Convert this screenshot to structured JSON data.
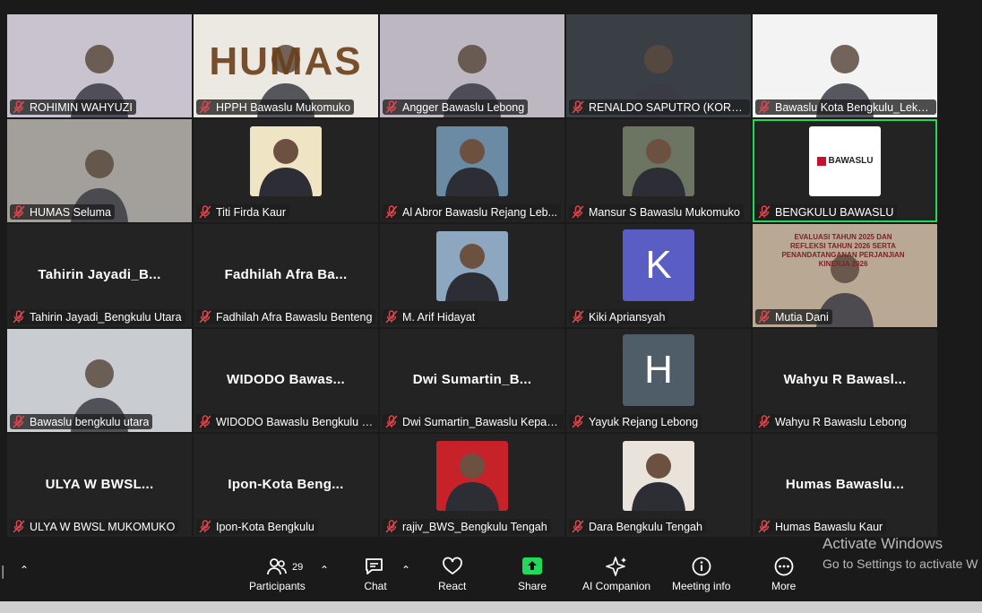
{
  "participants": [
    {
      "name": "ROHIMIN WAHYUZI",
      "type": "video",
      "bg": "#c8c3cf"
    },
    {
      "name": "HPPH Bawaslu Mukomuko",
      "type": "video",
      "bg": "#ece8e2",
      "overlay_text": "HUMAS"
    },
    {
      "name": "Angger Bawaslu Lebong",
      "type": "video",
      "bg": "#bdb7c2"
    },
    {
      "name": "RENALDO SAPUTRO (KORDIV...",
      "type": "video",
      "bg": "#3a3f45"
    },
    {
      "name": "Bawaslu Kota Bengkulu_Leka ...",
      "type": "video",
      "bg": "#f3f3f3"
    },
    {
      "name": "HUMAS Seluma",
      "type": "video",
      "bg": "#a3a09c"
    },
    {
      "name": "Titi Firda Kaur",
      "type": "photo",
      "bg": "#efe5c4"
    },
    {
      "name": "Al Abror Bawaslu Rejang Leb...",
      "type": "photo",
      "bg": "#6b8aa3"
    },
    {
      "name": "Mansur S Bawaslu Mukomuko",
      "type": "photo",
      "bg": "#6c7561"
    },
    {
      "name": "BENGKULU BAWASLU",
      "type": "logo",
      "bg": "#ffffff",
      "active": true,
      "logo_text": "BAWASLU"
    },
    {
      "name": "Tahirin Jayadi_Bengkulu Utara",
      "type": "name",
      "display": "Tahirin Jayadi_B..."
    },
    {
      "name": "Fadhilah Afra Bawaslu Benteng",
      "type": "name",
      "display": "Fadhilah Afra Ba..."
    },
    {
      "name": "M. Arif Hidayat",
      "type": "photo",
      "bg": "#8ea7c0"
    },
    {
      "name": "Kiki Apriansyah",
      "type": "avatar",
      "letter": "K",
      "bg": "#5a5ec4"
    },
    {
      "name": "Mutia Dani",
      "type": "video",
      "bg": "#b9a893",
      "overlay_text": "EVALUASI TAHUN 2025 DAN REFLEKSI TAHUN 2026 SERTA PENANDATANGANAN PERJANJIAN KINERJA 2026"
    },
    {
      "name": "Bawaslu bengkulu utara",
      "type": "video",
      "bg": "#c9ccd0"
    },
    {
      "name": "WIDODO Bawaslu Bengkulu S...",
      "type": "name",
      "display": "WIDODO Bawas..."
    },
    {
      "name": "Dwi Sumartin_Bawaslu Kepahi...",
      "type": "name",
      "display": "Dwi Sumartin_B..."
    },
    {
      "name": "Yayuk Rejang Lebong",
      "type": "avatar",
      "letter": "H",
      "bg": "#4e5d68"
    },
    {
      "name": "Wahyu R Bawaslu Lebong",
      "type": "name",
      "display": "Wahyu R Bawasl..."
    },
    {
      "name": "ULYA W  BWSL MUKOMUKO",
      "type": "name",
      "display": "ULYA W  BWSL..."
    },
    {
      "name": "Ipon-Kota Bengkulu",
      "type": "name",
      "display": "Ipon-Kota Beng..."
    },
    {
      "name": "rajiv_BWS_Bengkulu Tengah",
      "type": "photo",
      "bg": "#c7212a"
    },
    {
      "name": "Dara Bengkulu Tengah",
      "type": "photo",
      "bg": "#e9e3dc"
    },
    {
      "name": "Humas Bawaslu Kaur",
      "type": "name",
      "display": "Humas Bawaslu..."
    }
  ],
  "toolbar": {
    "participants_label": "Participants",
    "participants_count": "29",
    "chat_label": "Chat",
    "react_label": "React",
    "share_label": "Share",
    "ai_label": "AI Companion",
    "meeting_info_label": "Meeting info",
    "more_label": "More"
  },
  "watermark": {
    "title": "Activate Windows",
    "subtitle": "Go to Settings to activate W"
  },
  "colors": {
    "active_border": "#23d959",
    "share_green": "#23d959",
    "mic_muted": "#e0464b"
  }
}
